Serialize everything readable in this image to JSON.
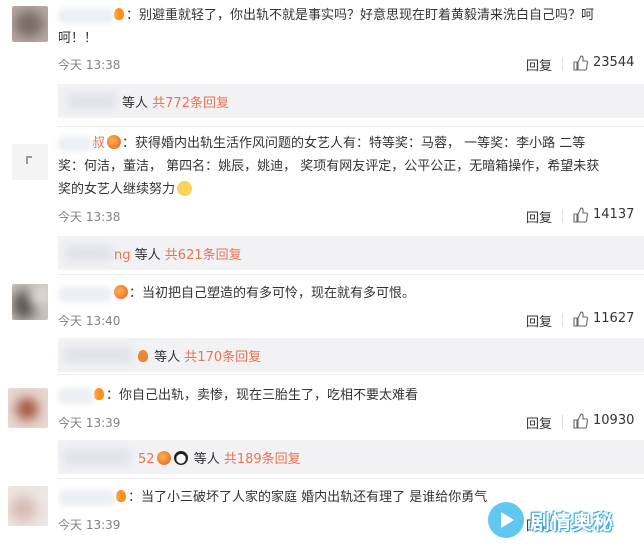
{
  "comments": [
    {
      "name": "",
      "text": "别避重就轻了，你出轨不就是事实吗？好意思现在盯着黄毅清来洗白自己吗？呵呵！！",
      "line1": "别避重就轻了，你出轨不就是事实吗？好意思现在盯着黄毅清来洗白自己吗？呵",
      "line2": "呵！！",
      "time": "今天 13:38",
      "reply_label": "回复",
      "likes": "23544",
      "replies": {
        "prefix": "",
        "people": "等人",
        "count": "共772条回复"
      }
    },
    {
      "name": "叔",
      "line1": "获得婚内出轨生活作风问题的女艺人有：特等奖：马蓉，  一等奖：李小路   二等",
      "line2": "奖：何洁，董洁，  第四名：姚辰，姚迪，   奖项有网友评定，公平公正，无暗箱操作，希望未获",
      "line3": "奖的女艺人继续努力",
      "time": "今天 13:38",
      "reply_label": "回复",
      "likes": "14137",
      "replies": {
        "prefix": "ng",
        "people": "等人",
        "count": "共621条回复"
      }
    },
    {
      "name": "",
      "line1": "当初把自己塑造的有多可怜，现在就有多可恨。",
      "time": "今天 13:40",
      "reply_label": "回复",
      "likes": "11627",
      "replies": {
        "prefix": "",
        "people": "等人",
        "count": "共170条回复"
      }
    },
    {
      "name": "",
      "line1": "你自己出轨，卖惨，现在三胎生了，吃相不要太难看",
      "time": "今天 13:39",
      "reply_label": "回复",
      "likes": "10930",
      "replies": {
        "prefix": "52",
        "people": "等人",
        "count": "共189条回复"
      }
    },
    {
      "name": "",
      "line1": "当了小三破坏了人家的家庭 婚内出轨还有理了 是谁给你勇气",
      "time": "今天 13:39",
      "reply_label": "回复",
      "likes": ""
    }
  ],
  "watermark": {
    "text": "剧情奥秘"
  },
  "colors": {
    "accent": "#eb7350",
    "reply_bg": "#f2f2f5",
    "meta": "#808080"
  }
}
